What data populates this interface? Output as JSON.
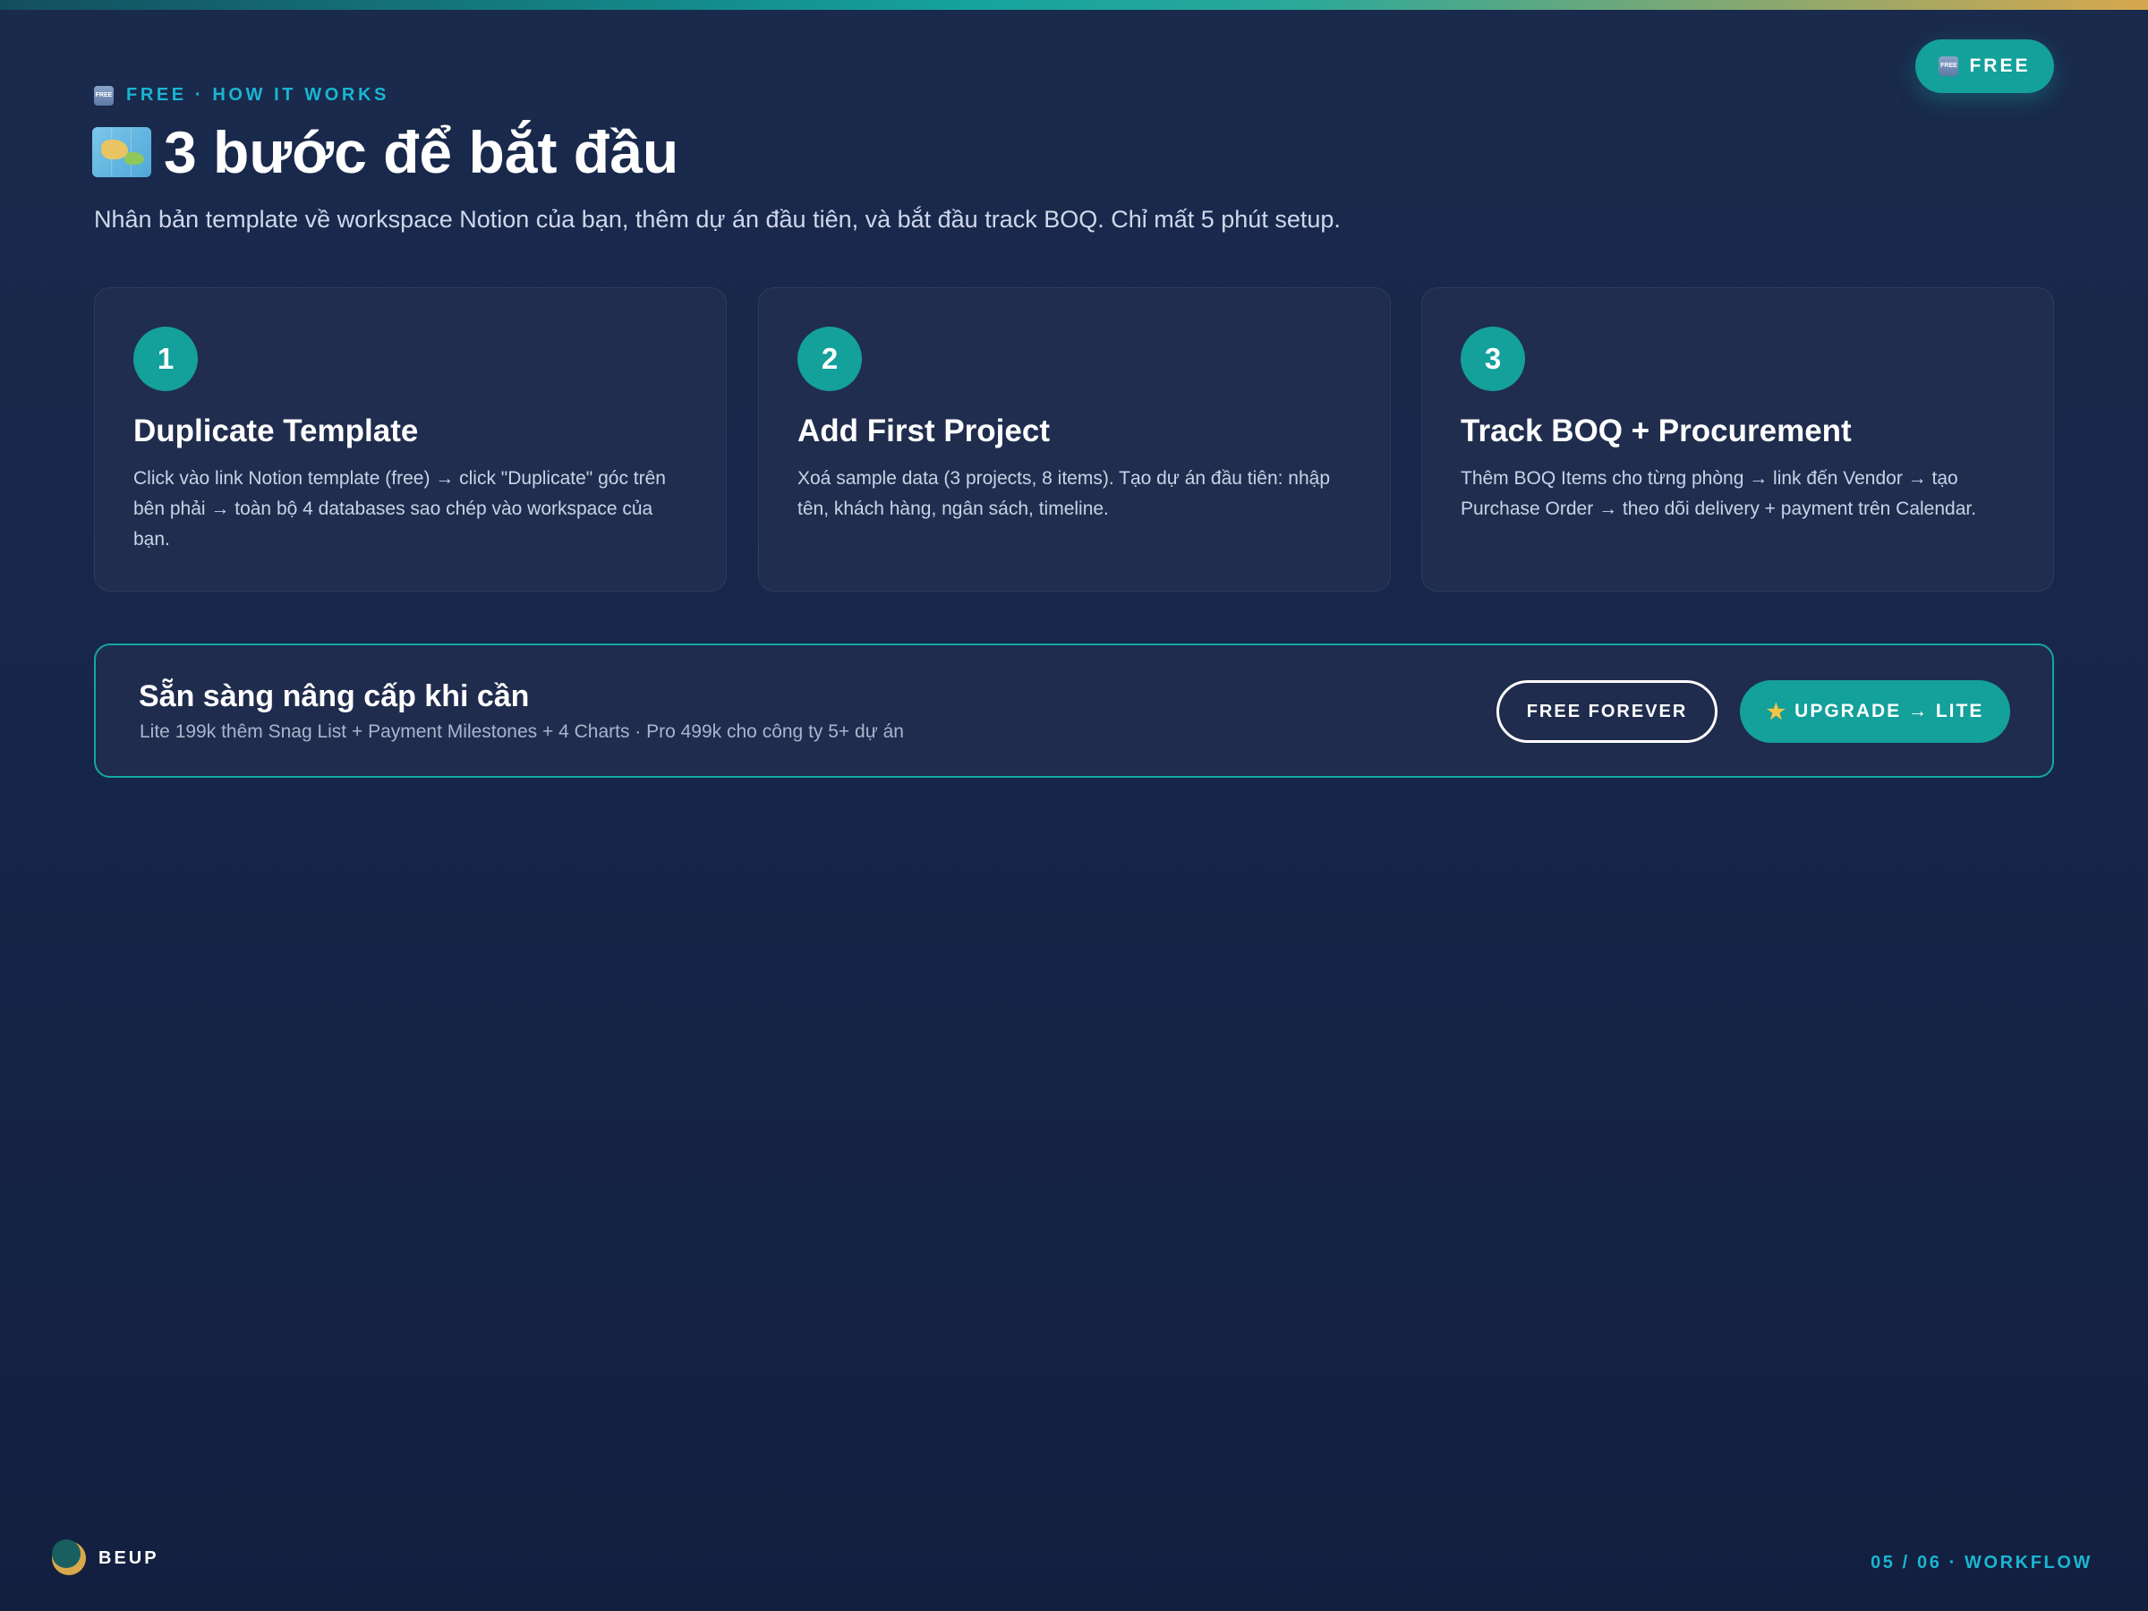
{
  "header": {
    "badge": {
      "icon": "free-icon",
      "label": "FREE"
    },
    "eyebrow": {
      "icon": "free-icon",
      "text": "FREE · HOW IT WORKS"
    },
    "title": {
      "icon": "world-map-icon",
      "text": "3 bước để bắt đầu"
    },
    "subtitle": "Nhân bản template về workspace Notion của bạn, thêm dự án đầu tiên, và bắt đầu track BOQ. Chỉ mất 5 phút setup."
  },
  "steps": [
    {
      "number": "1",
      "title": "Duplicate Template",
      "description": "Click vào link Notion template (free) → click \"Duplicate\" góc trên bên phải → toàn bộ 4 databases sao chép vào workspace của bạn."
    },
    {
      "number": "2",
      "title": "Add First Project",
      "description": "Xoá sample data (3 projects, 8 items). Tạo dự án đầu tiên: nhập tên, khách hàng, ngân sách, timeline."
    },
    {
      "number": "3",
      "title": "Track BOQ + Procurement",
      "description": "Thêm BOQ Items cho từng phòng → link đến Vendor → tạo Purchase Order → theo dõi delivery + payment trên Calendar."
    }
  ],
  "cta": {
    "title": "Sẵn sàng nâng cấp khi cần",
    "subtitle": "Lite 199k thêm Snag List + Payment Milestones + 4 Charts · Pro 499k cho công ty 5+ dự án",
    "secondary_label": "FREE FOREVER",
    "primary_label": "UPGRADE → LITE",
    "primary_icon": "star-icon"
  },
  "footer": {
    "brand": "BEUP",
    "page_indicator": "05 / 06 · WORKFLOW"
  },
  "colors": {
    "accent": "#14a09b",
    "eyebrow": "#19b6d2",
    "background": "#1a2a4c",
    "card": "#202d4e",
    "brand_gold": "#d9a84a"
  }
}
